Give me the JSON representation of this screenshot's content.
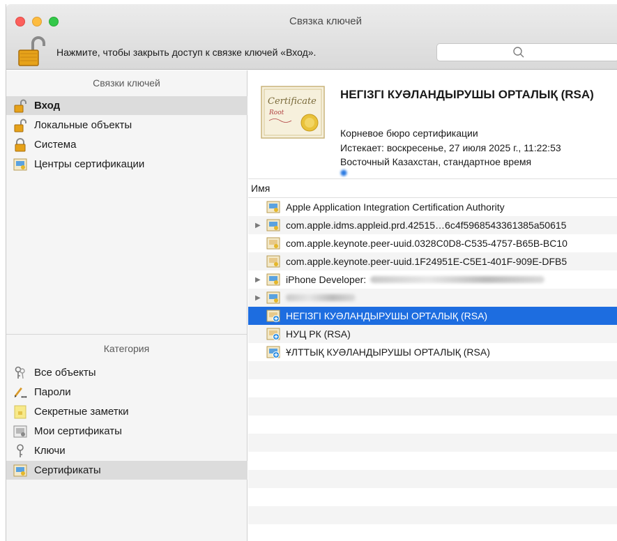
{
  "window": {
    "title": "Связка ключей"
  },
  "toolbar": {
    "lock_message": "Нажмите, чтобы закрыть доступ к связке ключей «Вход».",
    "search_placeholder": ""
  },
  "sidebar": {
    "keychains_header": "Связки ключей",
    "keychains": [
      {
        "label": "Вход",
        "icon": "unlocked-padlock-icon",
        "selected": true
      },
      {
        "label": "Локальные объекты",
        "icon": "unlocked-padlock-icon",
        "selected": false
      },
      {
        "label": "Система",
        "icon": "locked-padlock-icon",
        "selected": false
      },
      {
        "label": "Центры сертификации",
        "icon": "certificate-icon",
        "selected": false
      }
    ],
    "category_header": "Категория",
    "categories": [
      {
        "label": "Все объекты",
        "icon": "keys-icon",
        "selected": false
      },
      {
        "label": "Пароли",
        "icon": "pencil-icon",
        "selected": false
      },
      {
        "label": "Секретные заметки",
        "icon": "secure-note-icon",
        "selected": false
      },
      {
        "label": "Мои сертификаты",
        "icon": "my-certificate-icon",
        "selected": false
      },
      {
        "label": "Ключи",
        "icon": "key-icon",
        "selected": false
      },
      {
        "label": "Сертификаты",
        "icon": "certificate-icon",
        "selected": true
      }
    ]
  },
  "detail": {
    "title": "НЕГІЗГІ КУӘЛАНДЫРУШЫ ОРТАЛЫҚ (RSA)",
    "kind": "Корневое бюро сертификации",
    "expires": "Истекает: воскресенье, 27 июля 2025 г., 11:22:53",
    "timezone": "Восточный Казахстан, стандартное время"
  },
  "list": {
    "column_name": "Имя",
    "rows": [
      {
        "label": "Apple Application Integration Certification Authority",
        "expandable": false,
        "selected": false,
        "icon": "cert-icon"
      },
      {
        "label": "com.apple.idms.appleid.prd.42515…6c4f5968543361385a50615",
        "expandable": true,
        "selected": false,
        "icon": "cert-icon"
      },
      {
        "label": "com.apple.keynote.peer-uuid.0328C0D8-C535-4757-B65B-BC10",
        "expandable": false,
        "selected": false,
        "icon": "cert-icon"
      },
      {
        "label": "com.apple.keynote.peer-uuid.1F24951E-C5E1-401F-909E-DFB5",
        "expandable": false,
        "selected": false,
        "icon": "cert-icon"
      },
      {
        "label": "iPhone Developer:",
        "expandable": true,
        "selected": false,
        "icon": "cert-icon"
      },
      {
        "label": "",
        "expandable": true,
        "selected": false,
        "icon": "cert-icon"
      },
      {
        "label": "НЕГІЗГІ КУӘЛАНДЫРУШЫ ОРТАЛЫҚ (RSA)",
        "expandable": false,
        "selected": true,
        "icon": "root-cert-icon"
      },
      {
        "label": "НУЦ РК (RSA)",
        "expandable": false,
        "selected": false,
        "icon": "root-cert-icon"
      },
      {
        "label": "ҰЛТТЫҚ КУӘЛАНДЫРУШЫ ОРТАЛЫҚ (RSA)",
        "expandable": false,
        "selected": false,
        "icon": "root-cert-icon"
      }
    ]
  },
  "colors": {
    "selection": "#1d6de0",
    "sidebar_bg": "#f5f5f5",
    "sidebar_selected": "#dcdcdc"
  }
}
